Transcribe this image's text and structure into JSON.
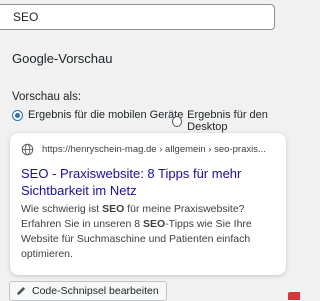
{
  "seo_field": {
    "value": "SEO"
  },
  "section_title": "Google-Vorschau",
  "preview_as": {
    "label": "Vorschau als:",
    "options": [
      {
        "label": "Ergebnis für die mobilen Geräte",
        "selected": true
      },
      {
        "label": "Ergebnis für den Desktop",
        "selected": false
      }
    ]
  },
  "serp": {
    "url": "https://henryschein-mag.de › allgemein › seo-praxis...",
    "title": "SEO - Praxiswebsite: 8 Tipps für mehr Sichtbarkeit im Netz",
    "desc_parts": [
      "Wie schwierig ist ",
      "SEO",
      " für meine Praxiswebsite? Erfahren Sie in unseren 8 ",
      "SEO",
      "-Tipps wie Sie Ihre Website für Suchmaschine und Patienten einfach optimieren."
    ]
  },
  "edit_button": {
    "label": "Code-Schnipsel bearbeiten",
    "icon": "pencil-icon"
  },
  "colors": {
    "accent": "#2271b1",
    "link": "#1a0dab",
    "badge": "#d63638"
  }
}
